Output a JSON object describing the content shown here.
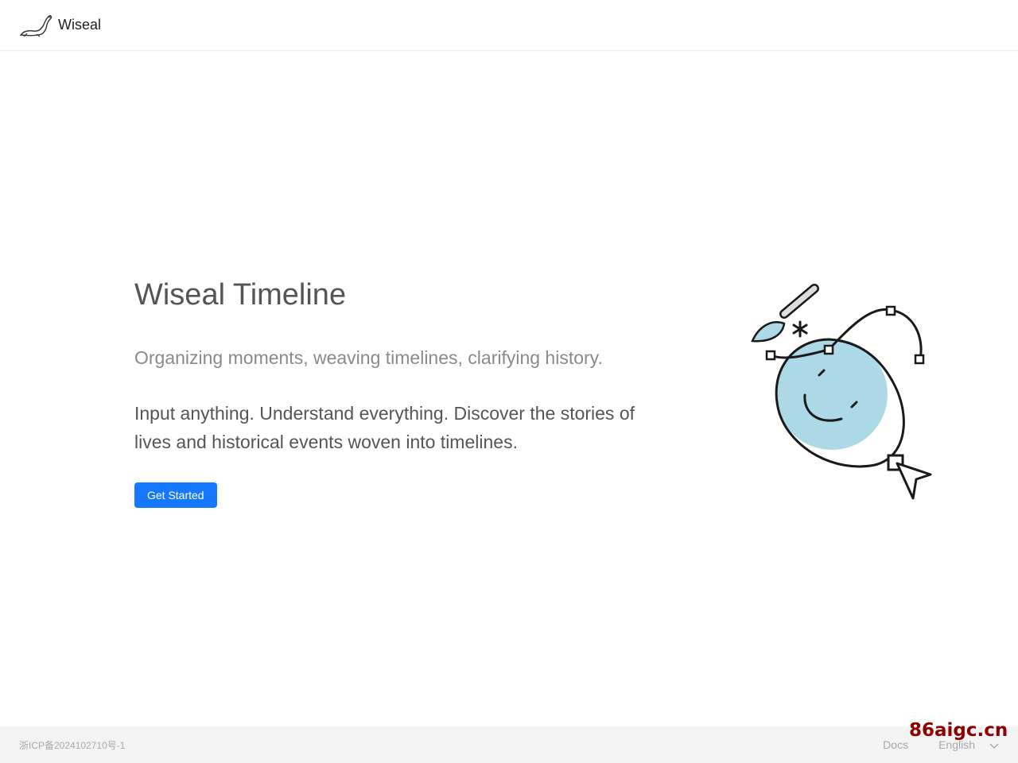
{
  "header": {
    "logo_icon": "seal-icon",
    "app_name": "Wiseal"
  },
  "hero": {
    "title": "Wiseal Timeline",
    "subtitle": "Organizing moments, weaving timelines, clarifying history.",
    "description": "Input anything. Understand everything. Discover the stories of lives and historical events woven into timelines.",
    "cta_label": "Get Started",
    "illustration": "smiley-bezier-illustration"
  },
  "footer": {
    "icp": "浙ICP备2024102710号-1",
    "docs_label": "Docs",
    "language_selected": "English",
    "language_icon": "chevron-down-icon"
  },
  "watermark": {
    "text": "86aigc.cn",
    "color": "#8b0000"
  },
  "colors": {
    "accent": "#1677ff",
    "illustration_fill": "#add8e6",
    "footer_bg": "#f3f3f3"
  }
}
